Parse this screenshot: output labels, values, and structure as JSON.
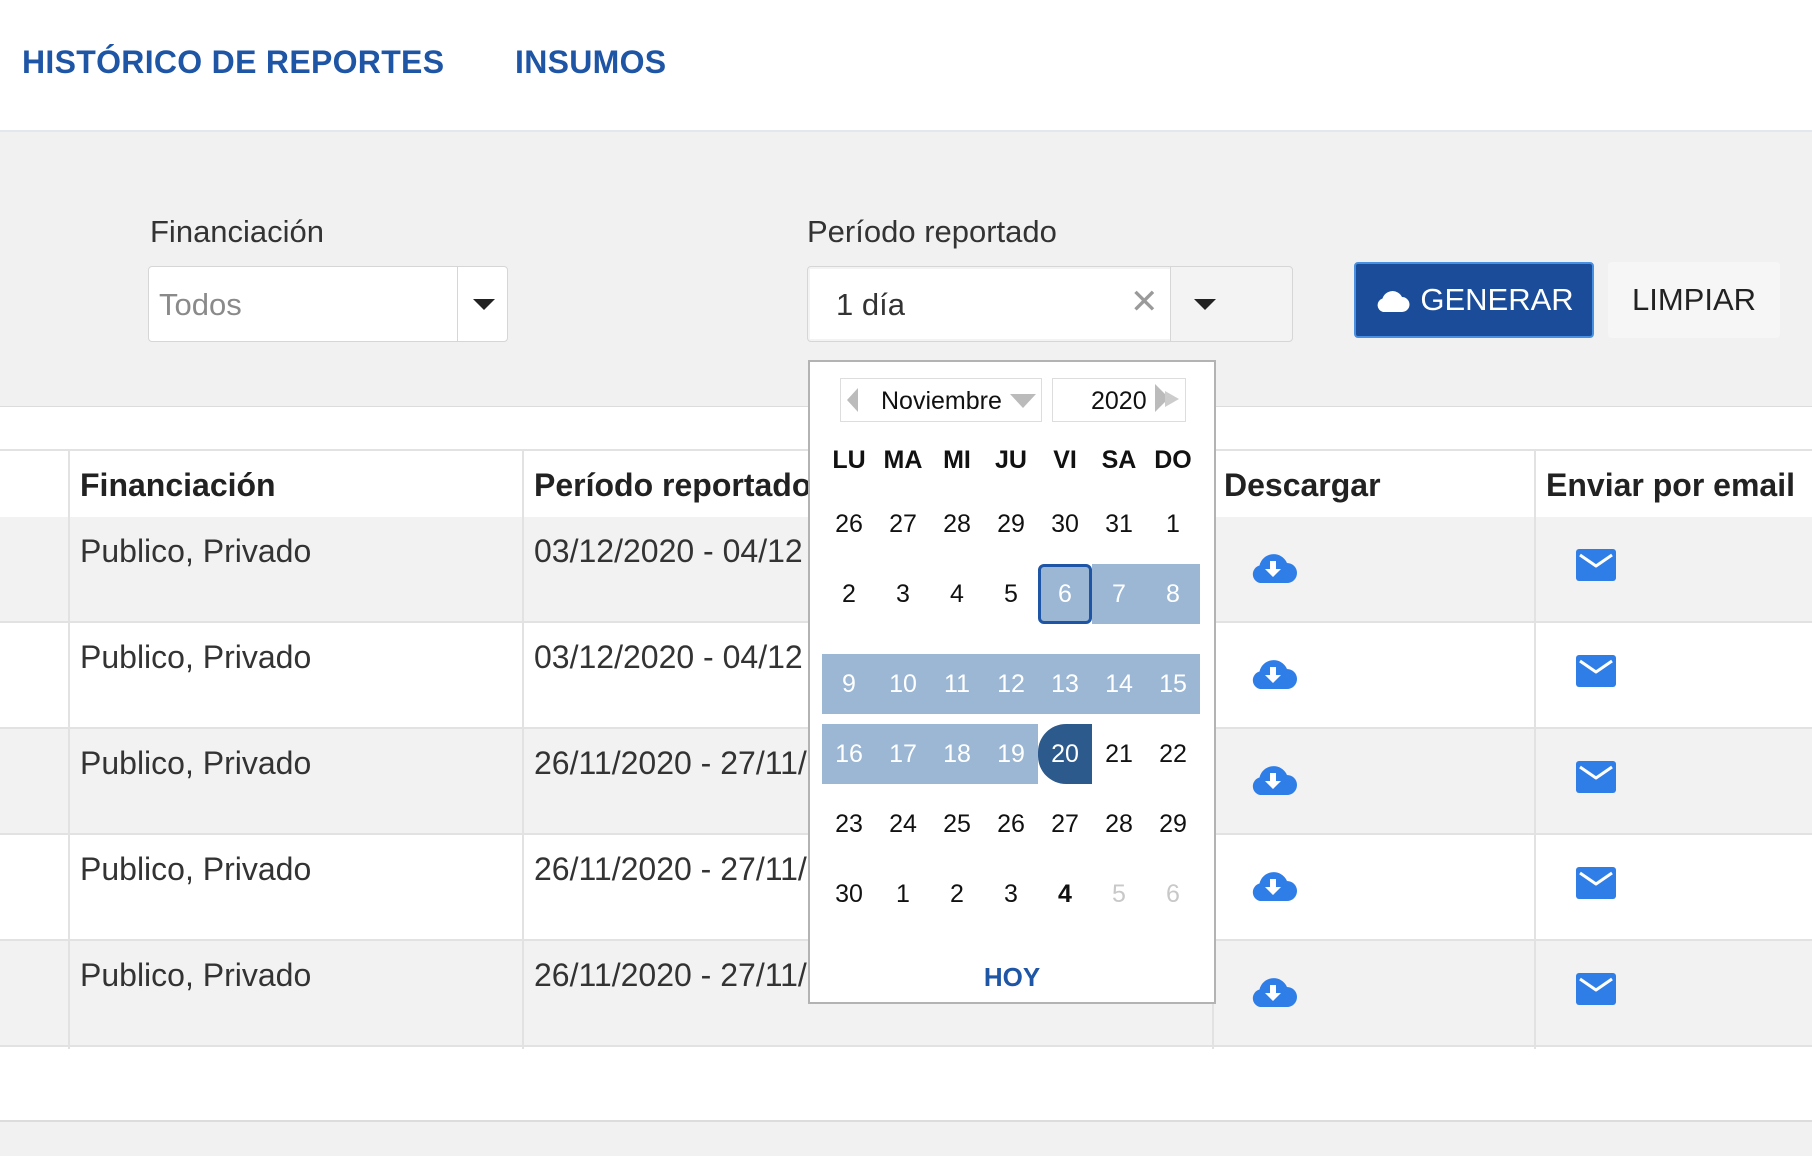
{
  "nav": {
    "tabs": [
      "HISTÓRICO DE REPORTES",
      "INSUMOS"
    ]
  },
  "filters": {
    "financing_label": "Financiación",
    "financing_value": "Todos",
    "period_label": "Período reportado",
    "period_value": "1 día",
    "clear_symbol": "✕",
    "generate_label": "GENERAR",
    "clear_label": "LIMPIAR"
  },
  "table": {
    "headers": [
      "Financiación",
      "Período reportado",
      "Descargar",
      "Enviar por email"
    ],
    "rows": [
      {
        "financing": "Publico, Privado",
        "period": "03/12/2020 - 04/12"
      },
      {
        "financing": "Publico, Privado",
        "period": "03/12/2020 - 04/12"
      },
      {
        "financing": "Publico, Privado",
        "period": "26/11/2020 - 27/11/"
      },
      {
        "financing": "Publico, Privado",
        "period": "26/11/2020 - 27/11/"
      },
      {
        "financing": "Publico, Privado",
        "period": "26/11/2020 - 27/11/"
      }
    ],
    "download_icon": "cloud-download-icon",
    "email_icon": "envelope-icon"
  },
  "calendar": {
    "month": "Noviembre",
    "year": "2020",
    "weekdays": [
      "LU",
      "MA",
      "MI",
      "JU",
      "VI",
      "SA",
      "DO"
    ],
    "weeks": [
      [
        "26",
        "27",
        "28",
        "29",
        "30",
        "31",
        "1"
      ],
      [
        "2",
        "3",
        "4",
        "5",
        "6",
        "7",
        "8"
      ],
      [
        "9",
        "10",
        "11",
        "12",
        "13",
        "14",
        "15"
      ],
      [
        "16",
        "17",
        "18",
        "19",
        "20",
        "21",
        "22"
      ],
      [
        "23",
        "24",
        "25",
        "26",
        "27",
        "28",
        "29"
      ],
      [
        "30",
        "1",
        "2",
        "3",
        "4",
        "5",
        "6"
      ]
    ],
    "range_start": "6",
    "range_end": "20",
    "today": "4",
    "muted_days": [
      "5",
      "6"
    ],
    "today_button": "HOY"
  },
  "colors": {
    "brand": "#1e55a5",
    "primary_button": "#1a4c9a",
    "range": "#9bb7d4",
    "range_end": "#2c5a8c",
    "icon_blue": "#2f7ee8"
  }
}
